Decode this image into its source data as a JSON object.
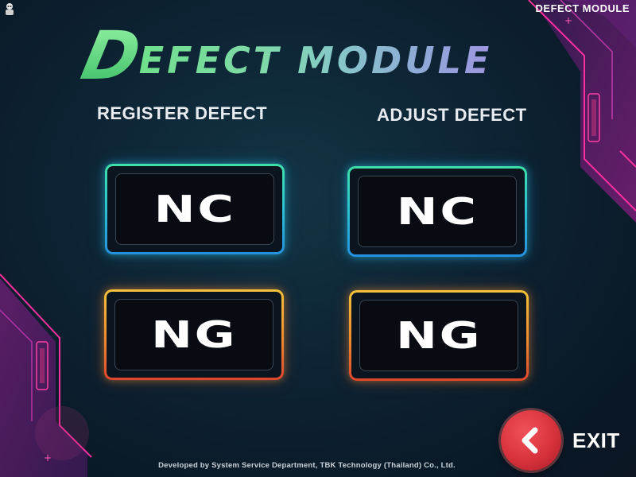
{
  "window": {
    "title": "DEFECT MODULE"
  },
  "header": {
    "title_first": "D",
    "title_rest": "EFECT MODULE"
  },
  "sections": {
    "register": {
      "label": "REGISTER DEFECT",
      "nc_label": "NC",
      "ng_label": "NG"
    },
    "adjust": {
      "label": "ADJUST DEFECT",
      "nc_label": "NC",
      "ng_label": "NG"
    }
  },
  "exit": {
    "label": "EXIT",
    "icon": "chevron-left-icon"
  },
  "footer": {
    "text": "Developed by System Service Department, TBK Technology (Thailand) Co., Ltd."
  },
  "colors": {
    "nc_border": "#2cc0d0",
    "ng_border": "#ee8a2e",
    "exit": "#d8323c",
    "accent_magenta": "#ff2fa0"
  }
}
